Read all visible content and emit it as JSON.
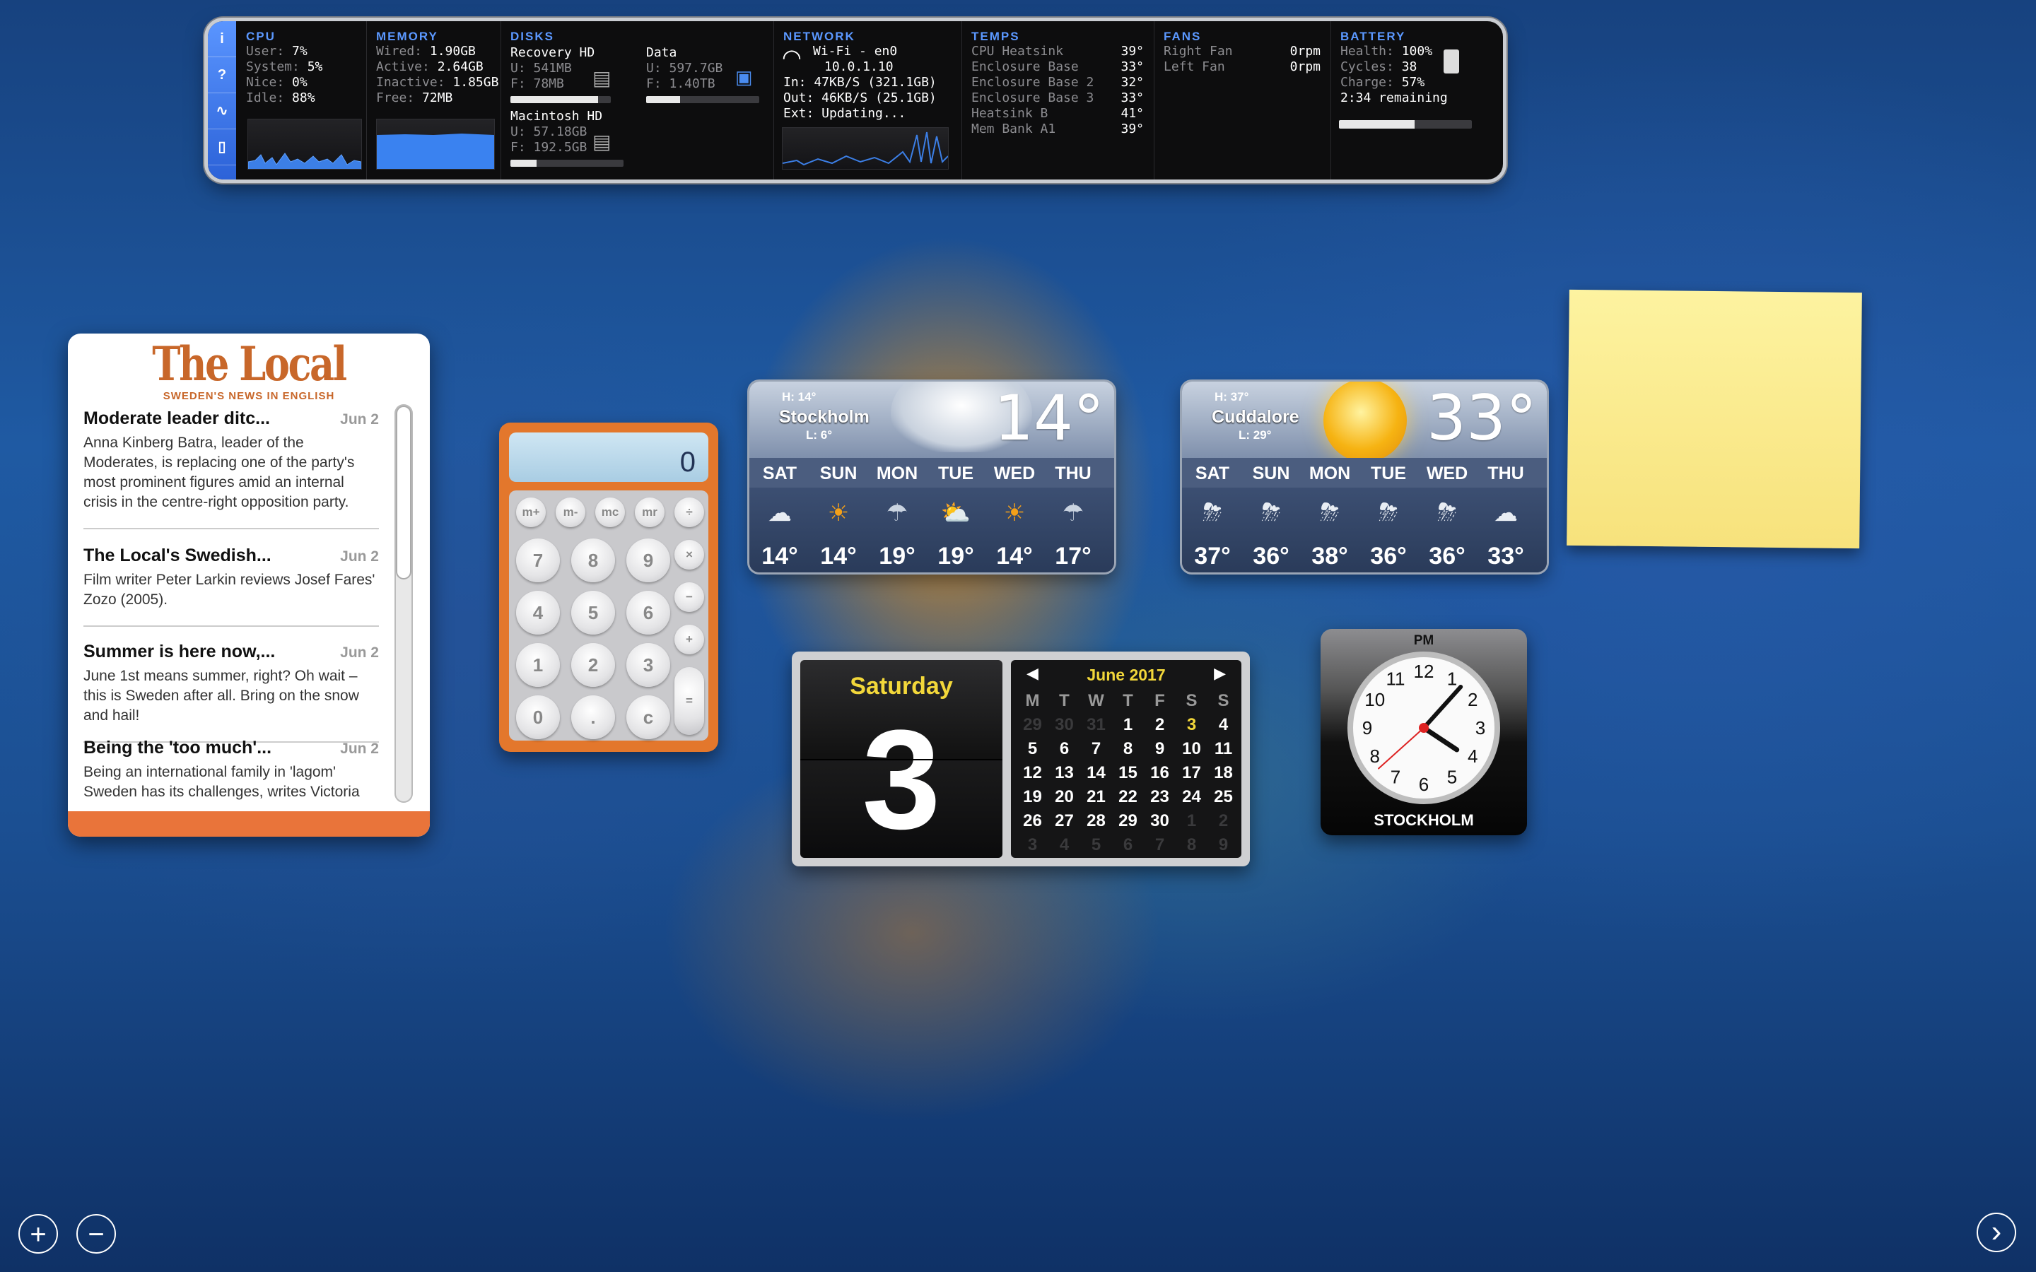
{
  "istat": {
    "side_icons": [
      "info-icon",
      "help-icon",
      "activity-icon",
      "phone-icon"
    ],
    "side_glyphs": [
      "i",
      "?",
      "∿",
      "▯"
    ],
    "cpu": {
      "title": "CPU",
      "rows": [
        [
          "User:",
          "7%"
        ],
        [
          "System:",
          "5%"
        ],
        [
          "Nice:",
          "0%"
        ],
        [
          "Idle:",
          "88%"
        ]
      ]
    },
    "memory": {
      "title": "MEMORY",
      "rows": [
        [
          "Wired:",
          "1.90GB"
        ],
        [
          "Active:",
          "2.64GB"
        ],
        [
          "Inactive:",
          "1.85GB"
        ],
        [
          "Free:",
          "72MB"
        ]
      ]
    },
    "disks": {
      "title": "DISKS",
      "items": [
        {
          "name": "Recovery HD",
          "used": "U: 541MB",
          "free": "F: 78MB",
          "fill": 0.87
        },
        {
          "name": "Data",
          "used": "U: 597.7GB",
          "free": "F: 1.40TB",
          "fill": 0.3
        },
        {
          "name": "Macintosh HD",
          "used": "U: 57.18GB",
          "free": "F: 192.5GB",
          "fill": 0.23
        }
      ]
    },
    "network": {
      "title": "NETWORK",
      "iface": "Wi-Fi - en0",
      "ip": "10.0.1.10",
      "in": "In: 47KB/S (321.1GB)",
      "out": "Out: 46KB/S (25.1GB)",
      "ext": "Ext: Updating..."
    },
    "temps": {
      "title": "TEMPS",
      "rows": [
        [
          "CPU Heatsink",
          "39°"
        ],
        [
          "Enclosure Base",
          "33°"
        ],
        [
          "Enclosure Base 2",
          "32°"
        ],
        [
          "Enclosure Base 3",
          "33°"
        ],
        [
          "Heatsink B",
          "41°"
        ],
        [
          "Mem Bank A1",
          "39°"
        ]
      ]
    },
    "fans": {
      "title": "FANS",
      "rows": [
        [
          "Right Fan",
          "0rpm"
        ],
        [
          "Left Fan",
          "0rpm"
        ]
      ]
    },
    "battery": {
      "title": "BATTERY",
      "rows": [
        [
          "Health:",
          "100%"
        ],
        [
          "Cycles:",
          "38"
        ],
        [
          "Charge:",
          "57%"
        ]
      ],
      "remaining": "2:34 remaining",
      "charge_fraction": 0.57
    }
  },
  "local": {
    "logo": "The Local",
    "tagline": "SWEDEN'S NEWS IN ENGLISH",
    "stories": [
      {
        "title": "Moderate leader ditc...",
        "date": "Jun 2",
        "body": "Anna Kinberg Batra, leader of the Moderates, is replacing one of the party's most prominent figures amid an internal crisis in the centre-right opposition party."
      },
      {
        "title": "The Local's Swedish...",
        "date": "Jun 2",
        "body": "Film writer Peter Larkin reviews Josef Fares' Zozo (2005)."
      },
      {
        "title": "Summer is here now,...",
        "date": "Jun 2",
        "body": "June 1st means summer, right? Oh wait – this is Sweden after all. Bring on the snow and hail!"
      },
      {
        "title": "Being the 'too much'...",
        "date": "Jun 2",
        "body": "Being an international family in 'lagom' Sweden has its challenges, writes Victoria"
      }
    ]
  },
  "calculator": {
    "display": "0",
    "memory_keys": [
      "m+",
      "m-",
      "mc",
      "mr"
    ],
    "op_keys": [
      "÷",
      "×",
      "−",
      "+",
      "="
    ],
    "digit_rows": [
      [
        "7",
        "8",
        "9"
      ],
      [
        "4",
        "5",
        "6"
      ],
      [
        "1",
        "2",
        "3"
      ],
      [
        "0",
        ".",
        "c"
      ]
    ]
  },
  "weather": [
    {
      "city": "Stockholm",
      "high": "H: 14°",
      "low": "L: 6°",
      "temp": "14°",
      "days": [
        "SAT",
        "SUN",
        "MON",
        "TUE",
        "WED",
        "THU"
      ],
      "temps": [
        "14°",
        "14°",
        "19°",
        "19°",
        "14°",
        "17°"
      ],
      "icons": [
        "cloudy-icon",
        "sun-rain-icon",
        "rain-icon",
        "sun-cloud-icon",
        "sun-rain-icon",
        "rain-icon"
      ],
      "glyphs": [
        "☁",
        "☀",
        "☂",
        "⛅",
        "☀",
        "☂"
      ],
      "colors": [
        "#e8edf3",
        "#f3a019",
        "#c9d3e0",
        "#f3a019",
        "#f3a019",
        "#c9d3e0"
      ]
    },
    {
      "city": "Cuddalore",
      "high": "H: 37°",
      "low": "L: 29°",
      "temp": "33°",
      "days": [
        "SAT",
        "SUN",
        "MON",
        "TUE",
        "WED",
        "THU"
      ],
      "temps": [
        "37°",
        "36°",
        "38°",
        "36°",
        "36°",
        "33°"
      ],
      "icons": [
        "thunderstorm-icon",
        "thunderstorm-icon",
        "thunderstorm-icon",
        "thunderstorm-icon",
        "thunderstorm-icon",
        "cloudy-icon"
      ],
      "glyphs": [
        "⛈",
        "⛈",
        "⛈",
        "⛈",
        "⛈",
        "☁"
      ],
      "colors": [
        "#e8edf3",
        "#e8edf3",
        "#e8edf3",
        "#e8edf3",
        "#e8edf3",
        "#e8edf3"
      ]
    }
  ],
  "calendar": {
    "weekday": "Saturday",
    "day": "3",
    "month": "June 2017",
    "headers": [
      "M",
      "T",
      "W",
      "T",
      "F",
      "S",
      "S"
    ],
    "weeks": [
      [
        "29",
        "30",
        "31",
        "1",
        "2",
        "3",
        "4"
      ],
      [
        "5",
        "6",
        "7",
        "8",
        "9",
        "10",
        "11"
      ],
      [
        "12",
        "13",
        "14",
        "15",
        "16",
        "17",
        "18"
      ],
      [
        "19",
        "20",
        "21",
        "22",
        "23",
        "24",
        "25"
      ],
      [
        "26",
        "27",
        "28",
        "29",
        "30",
        "1",
        "2"
      ],
      [
        "3",
        "4",
        "5",
        "6",
        "7",
        "8",
        "9"
      ]
    ],
    "today_index": [
      0,
      5
    ]
  },
  "clock": {
    "ampm": "PM",
    "city": "STOCKHOLM",
    "numbers": [
      "12",
      "1",
      "2",
      "3",
      "4",
      "5",
      "6",
      "7",
      "8",
      "9",
      "10",
      "11"
    ],
    "hour": 4,
    "minute": 7,
    "second": 38
  },
  "controls": {
    "add": "+",
    "remove": "−",
    "next": "›"
  }
}
